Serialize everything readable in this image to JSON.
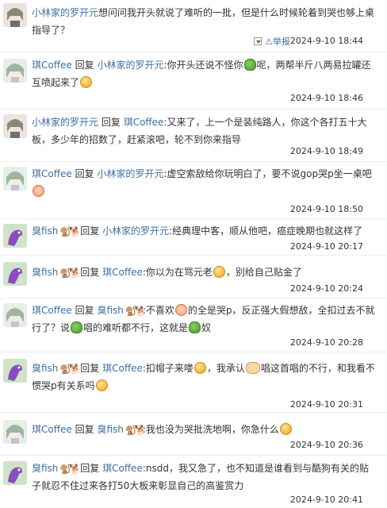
{
  "reply_word": "回复",
  "report_label": "举报",
  "comments": [
    {
      "user": "小林家的罗开元",
      "reply_to": "",
      "text_parts": [
        "想问问我开头就说了难听的一批，但是什么时候轮着到哭也够上桌指导了？"
      ],
      "time": "2024-9-10 18:44",
      "avatar": "anime-girl"
    },
    {
      "user": "琪Coffee",
      "reply_to": "小林家的罗开元",
      "text_parts": [
        ":你开头还说不怪你",
        "呢，两帮半斤八两易拉罐还互喷起来了"
      ],
      "time": "2024-9-10 18:46",
      "avatar": "anime-girl-green"
    },
    {
      "user": "小林家的罗开元",
      "reply_to": "琪Coffee",
      "text_parts": [
        ":又来了，上一个是装纯路人，你这个各打五十大板，多少年的招数了，赶紧滚吧，轮不到你来指导"
      ],
      "time": "2024-9-10 18:49",
      "avatar": "anime-girl"
    },
    {
      "user": "琪Coffee",
      "reply_to": "小林家的罗开元",
      "text_parts": [
        ":虚空索敌给你玩明白了，要不说gop哭p坐一桌吧"
      ],
      "time": "2024-9-10 18:50",
      "avatar": "anime-girl-green"
    },
    {
      "user": "臭fish",
      "reply_to": "小林家的罗开元",
      "text_parts": [
        ":经典理中客，顺从他吧，癌症晚期也就这样了"
      ],
      "time": "2024-9-10 20:17",
      "avatar": "dinosaur"
    },
    {
      "user": "臭fish",
      "reply_to": "琪Coffee",
      "text_parts": [
        ":你以为在骂元老",
        "，别给自己贴金了"
      ],
      "time": "2024-9-10 20:24",
      "avatar": "dinosaur"
    },
    {
      "user": "琪Coffee",
      "reply_to": "臭fish",
      "text_parts": [
        ":不喜欢",
        "的全是哭p，反正强大假想敌，全扣过去不就行了？说",
        "唱的难听都不行，这就是",
        "奴"
      ],
      "time": "2024-9-10 20:28",
      "avatar": "anime-girl-green"
    },
    {
      "user": "臭fish",
      "reply_to": "琪Coffee",
      "text_parts": [
        ":扣帽子来喽",
        "，我承认",
        "唱这首唱的不行，和我看不惯哭p有关系吗"
      ],
      "time": "2024-9-10 20:31",
      "avatar": "dinosaur"
    },
    {
      "user": "琪Coffee",
      "reply_to": "臭fish",
      "text_parts": [
        ":我也没为哭批洗地啊，你急什么"
      ],
      "time": "2024-9-10 20:36",
      "avatar": "anime-girl-green"
    },
    {
      "user": "臭fish",
      "reply_to": "琪Coffee",
      "text_parts": [
        ":nsdd，我又急了，也不知道是谁看到与酷狗有关的贴子就忍不住过来各打50大板来彰显自己的高鉴赏力"
      ],
      "time": "2024-9-10 20:41",
      "avatar": "dinosaur"
    }
  ]
}
